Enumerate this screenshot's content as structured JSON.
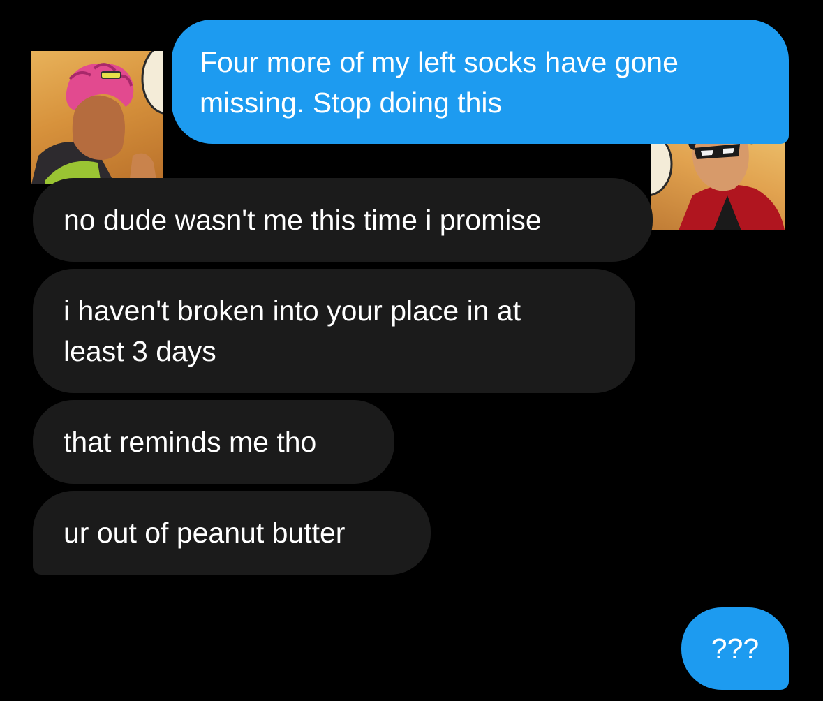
{
  "conversation": {
    "messages": [
      {
        "direction": "sent",
        "text": "Four more of my left socks have gone\nmissing. Stop doing this"
      },
      {
        "direction": "received",
        "text": "no dude wasn't me this time i promise"
      },
      {
        "direction": "received",
        "text": "i haven't broken into your place in at\nleast 3 days"
      },
      {
        "direction": "received",
        "text": "that reminds me tho"
      },
      {
        "direction": "received",
        "text": "ur out of peanut butter"
      },
      {
        "direction": "sent",
        "text": "???"
      }
    ]
  },
  "avatars": {
    "left": {
      "icon": "comic-character-pink-hair-avatar"
    },
    "right": {
      "icon": "comic-character-masked-red-suit-avatar"
    }
  },
  "colors": {
    "background": "#000000",
    "sent_bubble": "#1d9bf0",
    "received_bubble": "#1b1b1b",
    "text": "#ffffff"
  }
}
